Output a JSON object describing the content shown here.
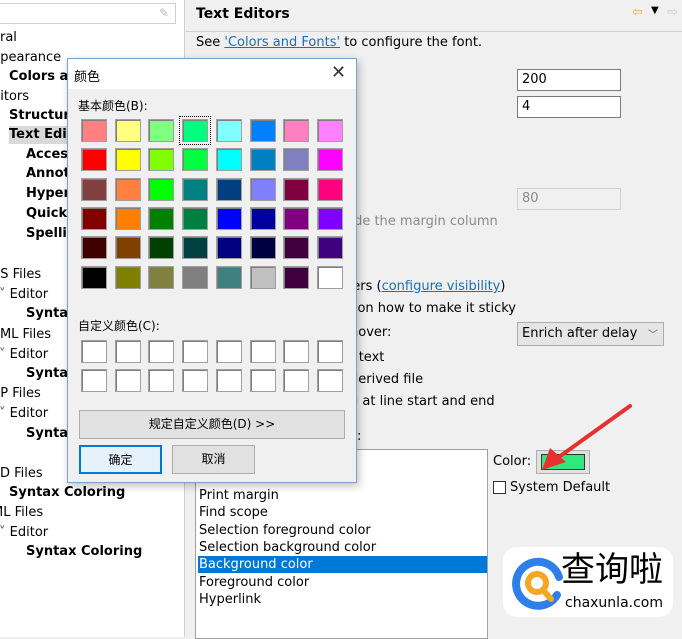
{
  "tree": {
    "items": [
      {
        "label": "eral",
        "bold": false,
        "indent": 0
      },
      {
        "label": "ppearance",
        "bold": false,
        "indent": 0
      },
      {
        "label": "Colors an",
        "bold": true,
        "indent": 1
      },
      {
        "label": "ditors",
        "bold": false,
        "indent": 0
      },
      {
        "label": "Structure",
        "bold": true,
        "indent": 1
      },
      {
        "label": "Text Edit",
        "bold": true,
        "indent": 1,
        "selected": true
      },
      {
        "label": "Access",
        "bold": true,
        "indent": 2
      },
      {
        "label": "Annot",
        "bold": true,
        "indent": 2
      },
      {
        "label": "Hyperl",
        "bold": true,
        "indent": 2
      },
      {
        "label": "Quick",
        "bold": true,
        "indent": 2
      },
      {
        "label": "Spellin",
        "bold": true,
        "indent": 2
      },
      {
        "label": "o",
        "bold": false,
        "indent": 0
      },
      {
        "label": "SS Files",
        "bold": false,
        "indent": 0
      },
      {
        "label": "Editor",
        "bold": false,
        "indent": 1,
        "expander": true
      },
      {
        "label": "Syntax",
        "bold": true,
        "indent": 2
      },
      {
        "label": "TML Files",
        "bold": false,
        "indent": 0
      },
      {
        "label": "Editor",
        "bold": false,
        "indent": 1,
        "expander": true
      },
      {
        "label": "Syntax",
        "bold": true,
        "indent": 2
      },
      {
        "label": "SP Files",
        "bold": false,
        "indent": 0
      },
      {
        "label": "Editor",
        "bold": false,
        "indent": 1,
        "expander": true
      },
      {
        "label": "Syntax",
        "bold": true,
        "indent": 2
      },
      {
        "label": "-",
        "bold": false,
        "indent": 0
      },
      {
        "label": "TD Files",
        "bold": false,
        "indent": 0
      },
      {
        "label": "Syntax Coloring",
        "bold": true,
        "indent": 1
      },
      {
        "label": "ML Files",
        "bold": false,
        "indent": 0
      },
      {
        "label": "Editor",
        "bold": false,
        "indent": 1,
        "expander": true
      },
      {
        "label": "Syntax Coloring",
        "bold": true,
        "indent": 2
      }
    ]
  },
  "page": {
    "title": "Text Editors",
    "see_prefix": "See ",
    "see_link": "'Colors and Fonts'",
    "see_suffix": " to configure the font.",
    "undo_history": "200",
    "tab_width": "4",
    "margin_column": "80",
    "override_margin": "rride the margin column",
    "whitespace_prefix": "cters (",
    "whitespace_link": "configure visibility",
    "whitespace_suffix": ")",
    "sticky_hover": "er on how to make it sticky",
    "hover_label": "hover:",
    "hover_select": "Enrich after delay",
    "drag_text": "f text",
    "derived_file": "derived file",
    "smart_caret": "g at line start and end",
    "appearance_options_label": ":",
    "color_options": [
      "Print margin",
      "Find scope",
      "Selection foreground color",
      "Selection background color",
      "Background color",
      "Foreground color",
      "Hyperlink"
    ],
    "selected_option": "Background color",
    "color_label": "Color:",
    "color_value": "#2EE880",
    "system_default": "System Default",
    "system_default_checked": false
  },
  "dialog": {
    "title": "颜色",
    "basic_label": "基本颜色(B):",
    "basic_colors": [
      [
        "#FF8080",
        "#FFFF80",
        "#80FF80",
        "#00FF80",
        "#80FFFF",
        "#0080FF",
        "#FF80C0",
        "#FF80FF"
      ],
      [
        "#FF0000",
        "#FFFF00",
        "#80FF00",
        "#00FF40",
        "#00FFFF",
        "#0080C0",
        "#8080C0",
        "#FF00FF"
      ],
      [
        "#804040",
        "#FF8040",
        "#00FF00",
        "#008080",
        "#004080",
        "#8080FF",
        "#800040",
        "#FF0080"
      ],
      [
        "#800000",
        "#FF8000",
        "#008000",
        "#008040",
        "#0000FF",
        "#0000A0",
        "#800080",
        "#8000FF"
      ],
      [
        "#400000",
        "#804000",
        "#004000",
        "#004040",
        "#000080",
        "#000040",
        "#400040",
        "#400080"
      ],
      [
        "#000000",
        "#808000",
        "#808040",
        "#808080",
        "#408080",
        "#C0C0C0",
        "#400040",
        "#FFFFFF"
      ]
    ],
    "selected_color": "#00FF80",
    "custom_label": "自定义颜色(C):",
    "define_custom": "规定自定义颜色(D) >>",
    "ok": "确定",
    "cancel": "取消"
  },
  "watermark": {
    "text": "查询啦",
    "domain": "chaxunla.com"
  }
}
